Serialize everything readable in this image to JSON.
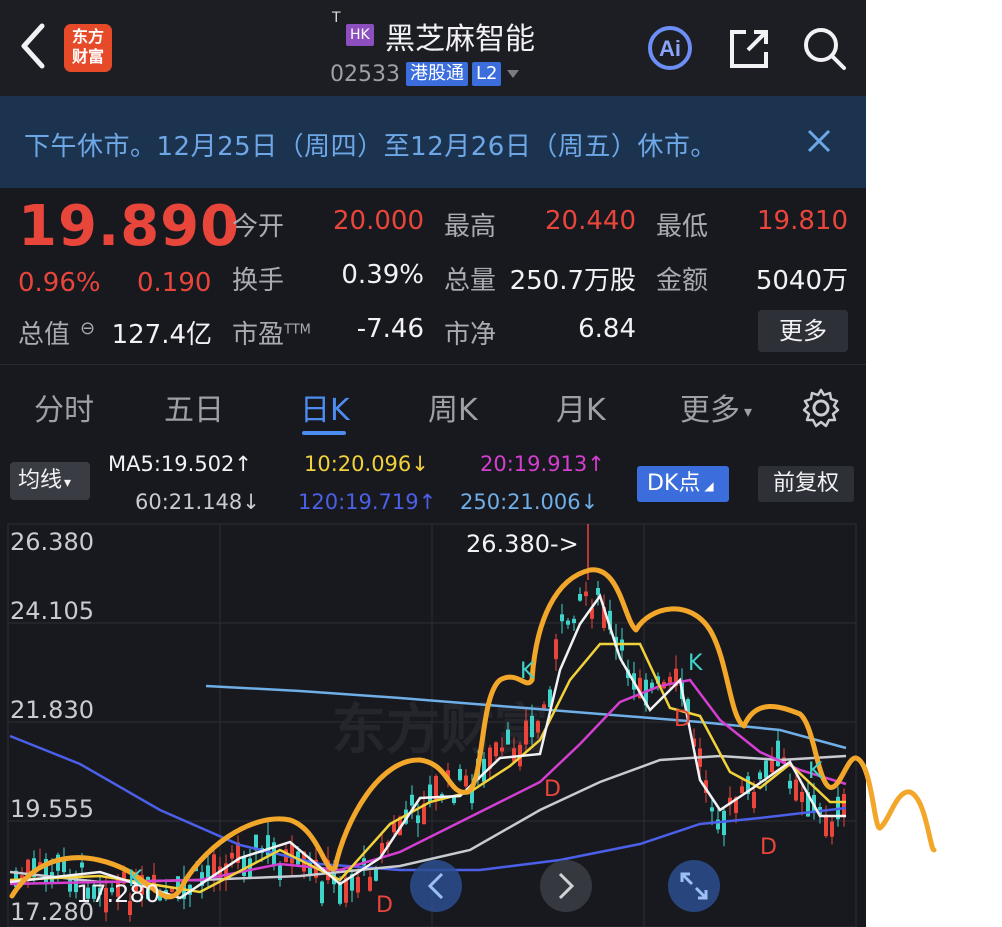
{
  "header": {
    "back_label": "返回",
    "logo_line1": "东方",
    "logo_line2": "财富",
    "t_mark": "T",
    "market_badge": "HK",
    "stock_name": "黑芝麻智能",
    "stock_code": "02533",
    "connect_badge": "港股通",
    "level_badge": "L2",
    "icons": [
      "ai-icon",
      "share-icon",
      "search-icon"
    ]
  },
  "notice": {
    "text": "下午休市。12月25日（周四）至12月26日（周五）休市。",
    "close_icon": "close-icon"
  },
  "quote": {
    "price": "19.890",
    "change_pct": "0.96%",
    "change": "0.190",
    "open_label": "今开",
    "open": "20.000",
    "high_label": "最高",
    "high": "20.440",
    "low_label": "最低",
    "low": "19.810",
    "turnover_label": "换手",
    "turnover": "0.39%",
    "volume_label": "总量",
    "volume": "250.7万股",
    "amount_label": "金额",
    "amount": "5040万",
    "mktcap_label": "总值",
    "mktcap": "127.4亿",
    "pe_label": "市盈",
    "pe_sup": "TTM",
    "pe": "-7.46",
    "pb_label": "市净",
    "pb": "6.84",
    "more_label": "更多"
  },
  "tabs": {
    "items": [
      "分时",
      "五日",
      "日K",
      "周K",
      "月K",
      "更多"
    ],
    "active": "日K",
    "settings_icon": "gear-icon"
  },
  "indicators": {
    "avg_label": "均线",
    "ma5": "MA5:19.502",
    "ma10": "10:20.096",
    "ma20": "20:19.913",
    "ma60": "60:21.148",
    "ma120": "120:19.719",
    "ma250": "250:21.006",
    "up_arrow": "↑",
    "down_arrow": "↓",
    "dk_label": "DK点",
    "adjust_label": "前复权",
    "colors": {
      "ma5": "#f2f2f4",
      "ma10": "#f1d23b",
      "ma20": "#d43fd0",
      "ma60": "#c9cbd2",
      "ma120": "#4b5fe8",
      "ma250": "#6faee6",
      "up": "#e8453b",
      "down": "#3fd3c9",
      "hand_drawn": "#f3a72a"
    }
  },
  "chart_data": {
    "type": "candlestick",
    "y_ticks": [
      "26.380",
      "24.105",
      "21.830",
      "19.555",
      "17.280"
    ],
    "max_label": "26.380->",
    "min_label": "17.280",
    "signals": [
      "K",
      "D"
    ],
    "watermark": "东方财富",
    "nav_icons": [
      "chevron-left-icon",
      "chevron-right-icon",
      "expand-icon"
    ]
  }
}
